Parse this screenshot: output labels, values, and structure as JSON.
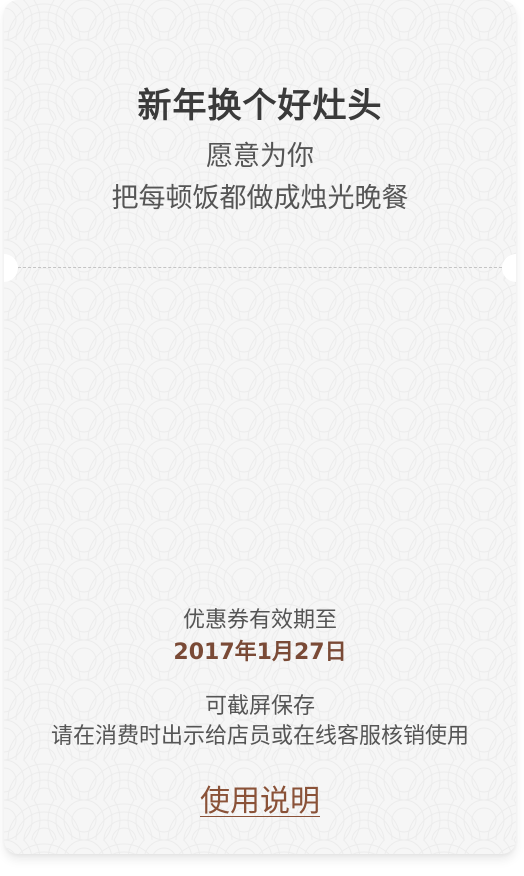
{
  "header": {
    "title": "新年换个好灶头",
    "subtitle_line1": "愿意为你",
    "subtitle_line2": "把每顿饭都做成烛光晚餐"
  },
  "validity": {
    "label": "优惠券有效期至",
    "date": "2017年1月27日"
  },
  "notes": {
    "save": "可截屏保存",
    "redeem": "请在消费时出示给店员或在线客服核销使用"
  },
  "link": {
    "usage": "使用说明"
  },
  "colors": {
    "background": "#f6f6f6",
    "text": "#555555",
    "accent": "#7a4a36",
    "link": "#8a5238"
  }
}
